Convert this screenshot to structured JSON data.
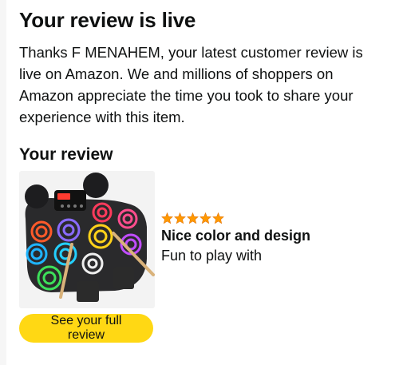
{
  "header": {
    "title": "Your review is live"
  },
  "intro": {
    "message": "Thanks F MENAHEM, your latest customer review is live on Amazon. We and millions of shoppers on Amazon appreciate the time you took to share your experience with this item."
  },
  "review": {
    "section_title": "Your review",
    "rating": 5,
    "max_rating": 5,
    "star_color": "#ff9900",
    "title": "Nice color and design",
    "body": "Fun to play with",
    "product_image": "electronic-drum-pad-kit-image"
  },
  "actions": {
    "full_review_label": "See your full review",
    "button_color": "#ffd814"
  }
}
